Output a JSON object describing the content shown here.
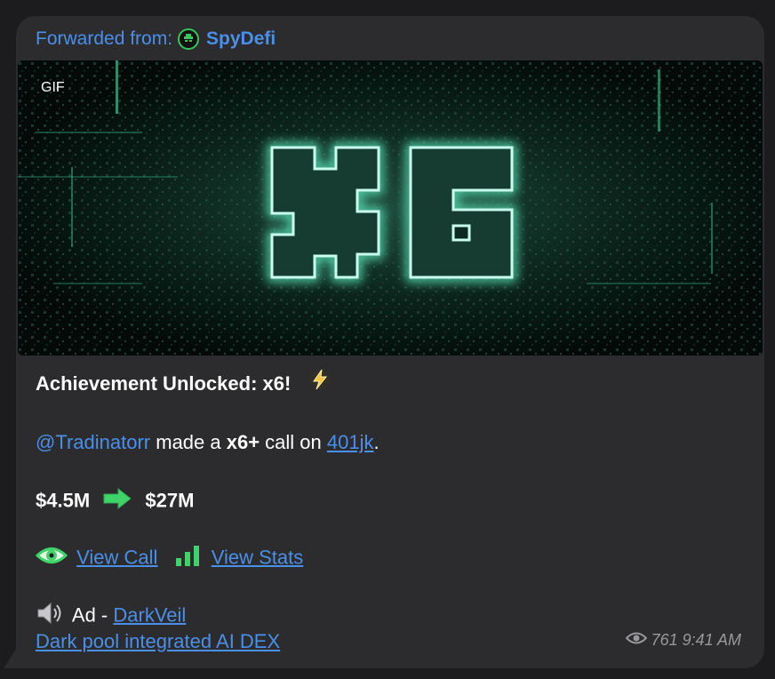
{
  "forward": {
    "prefix": "Forwarded from:",
    "name": "SpyDefi"
  },
  "media": {
    "badge": "GIF",
    "title_text": "x6"
  },
  "message": {
    "headline": "Achievement Unlocked: x6!",
    "mention": "@Tradinatorr",
    "made_a": " made a ",
    "multiplier": "x6+",
    "call_on": " call on ",
    "token": "401jk",
    "period": ".",
    "from_mcap": "$4.5M",
    "to_mcap": "$27M",
    "view_call": "View Call",
    "view_stats": "View Stats",
    "ad_prefix": "Ad - ",
    "ad_name": "DarkVeil",
    "ad_tagline": "Dark pool integrated AI DEX"
  },
  "meta": {
    "views": "761",
    "time": "9:41 AM"
  },
  "icons": {
    "avatar": "spy-avatar-icon",
    "lightning": "lightning-icon",
    "arrow": "right-arrow-icon",
    "eye": "eye-icon",
    "stats": "bar-chart-icon",
    "speaker": "speaker-icon",
    "views": "views-eye-icon"
  },
  "colors": {
    "link": "#4a8fe8",
    "bubble": "#2c2c2e",
    "neon": "#7ff5d0",
    "accent_green": "#34c759"
  }
}
